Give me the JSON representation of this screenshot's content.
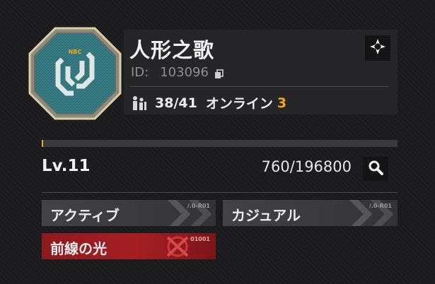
{
  "team": {
    "name": "人形之歌",
    "id_label": "ID:",
    "id_value": "103096",
    "members": "38/41",
    "online_label": "オンライン",
    "online_count": "3",
    "emblem_text": "NBC"
  },
  "level": {
    "label": "Lv.11",
    "exp": "760/196800",
    "progress_fraction": 0.004
  },
  "tags": [
    {
      "label": "アクティブ",
      "code": "/.0-R01"
    },
    {
      "label": "カジュアル",
      "code": "/.0-R01"
    },
    {
      "label": "前線の光",
      "code": "01001"
    }
  ],
  "colors": {
    "accent": "#f3a71e",
    "tag_red": "#a51f24",
    "emblem_teal": "#2f6f76",
    "emblem_gold": "#c9b98a"
  },
  "icons": {
    "locate": "crosshair-diamond-icon",
    "copy": "copy-icon",
    "members": "people-icon",
    "search": "search-icon"
  }
}
